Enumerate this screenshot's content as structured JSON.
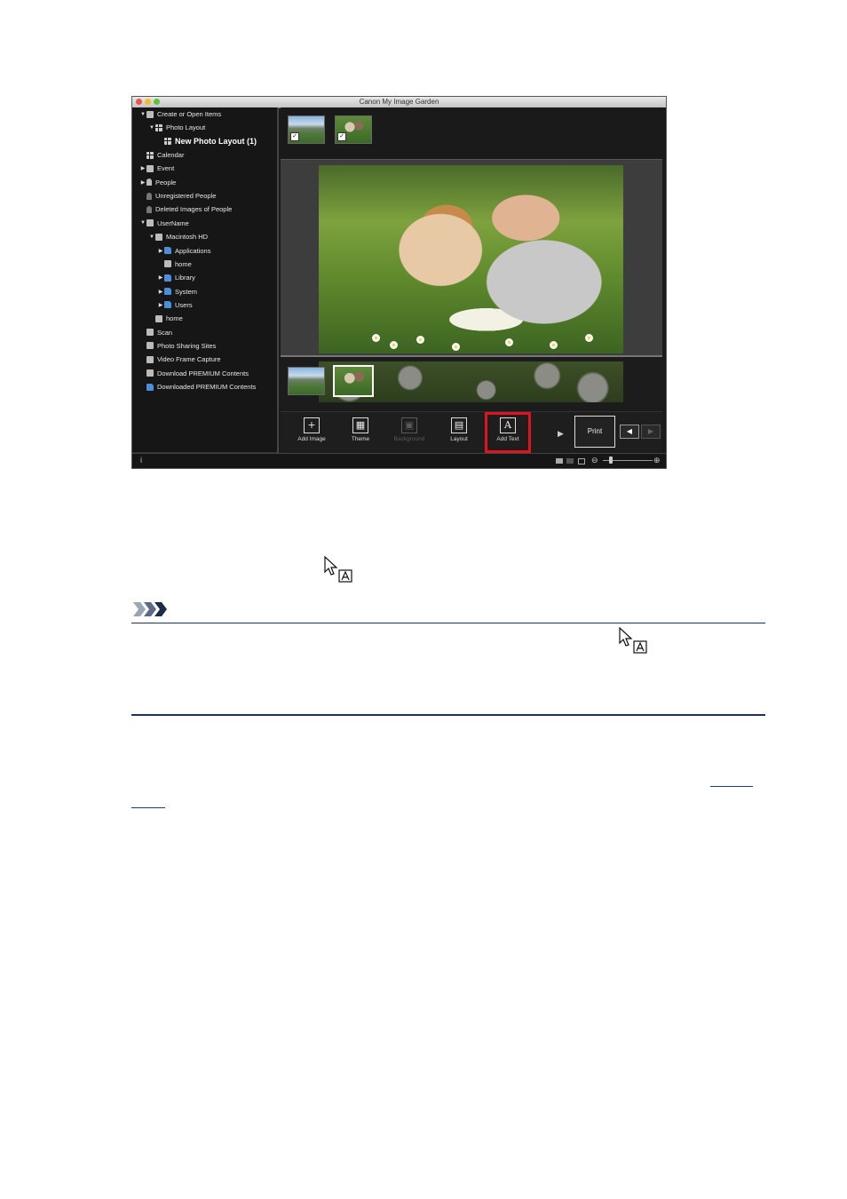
{
  "app": {
    "window_title": "Canon My Image Garden",
    "sidebar": {
      "items": [
        {
          "label": "Create or Open Items",
          "tri": "▼",
          "icon": "create-icon"
        },
        {
          "label": "Photo Layout",
          "tri": "▼",
          "icon": "photo-layout-icon"
        },
        {
          "label": "New Photo Layout (1)",
          "tri": "",
          "icon": "layout-grid-icon"
        },
        {
          "label": "Calendar",
          "tri": "",
          "icon": "calendar-icon"
        },
        {
          "label": "Event",
          "tri": "▶",
          "icon": "event-icon"
        },
        {
          "label": "People",
          "tri": "▶",
          "icon": "person-icon"
        },
        {
          "label": "Unregistered People",
          "tri": "",
          "icon": "person-icon"
        },
        {
          "label": "Deleted Images of People",
          "tri": "",
          "icon": "person-icon"
        },
        {
          "label": "UserName",
          "tri": "▼",
          "icon": "computer-icon"
        },
        {
          "label": "Macintosh HD",
          "tri": "▼",
          "icon": "hard-drive-icon"
        },
        {
          "label": "Applications",
          "tri": "▶",
          "icon": "folder-icon"
        },
        {
          "label": "home",
          "tri": "",
          "icon": "home-drive-icon"
        },
        {
          "label": "Library",
          "tri": "▶",
          "icon": "folder-icon"
        },
        {
          "label": "System",
          "tri": "▶",
          "icon": "folder-icon"
        },
        {
          "label": "Users",
          "tri": "▶",
          "icon": "folder-icon"
        },
        {
          "label": "home",
          "tri": "",
          "icon": "home-drive-icon"
        },
        {
          "label": "Scan",
          "tri": "",
          "icon": "scan-icon"
        },
        {
          "label": "Photo Sharing Sites",
          "tri": "",
          "icon": "sharing-icon"
        },
        {
          "label": "Video Frame Capture",
          "tri": "",
          "icon": "video-icon"
        },
        {
          "label": "Download PREMIUM Contents",
          "tri": "",
          "icon": "download-icon"
        },
        {
          "label": "Downloaded PREMIUM Contents",
          "tri": "",
          "icon": "folder-icon"
        }
      ]
    },
    "toolbar": {
      "add_image": "Add Image",
      "theme": "Theme",
      "background": "Background",
      "layout": "Layout",
      "add_text": "Add Text",
      "print": "Print",
      "prev_glyph": "◀",
      "next_glyph": "▶",
      "more_glyph": "▶"
    },
    "status": {
      "info_glyph": "i",
      "zoom_out": "⊖",
      "zoom_in": "⊕"
    }
  },
  "colors": {
    "highlight": "#e0141e",
    "note_rule": "#1c3360"
  }
}
